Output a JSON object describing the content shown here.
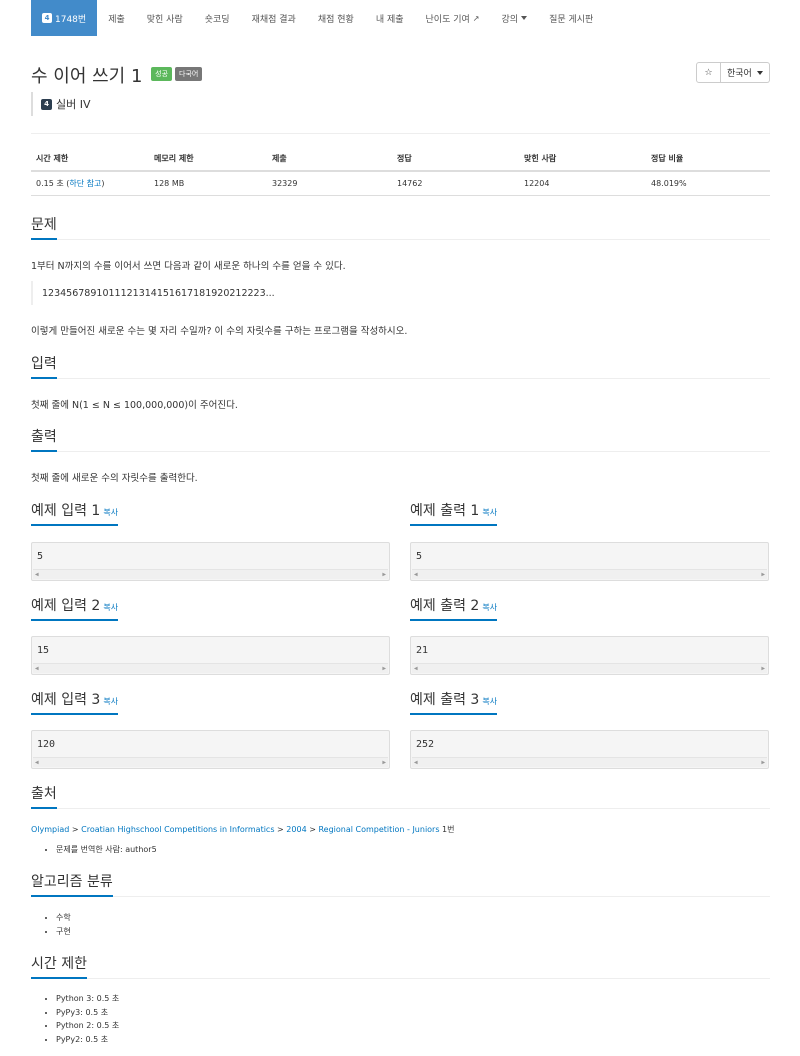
{
  "nav": {
    "problem_badge": "4",
    "problem_number": "1748번",
    "items": [
      "제출",
      "맞힌 사람",
      "숏코딩",
      "재채점 결과",
      "채점 현황",
      "내 제출",
      "난이도 기여",
      "강의",
      "질문 게시판"
    ]
  },
  "header": {
    "title": "수 이어 쓰기 1",
    "label_success": "성공",
    "label_multilang": "다국어",
    "star": "☆",
    "language": "한국어",
    "tier_badge": "4",
    "tier": "실버 IV"
  },
  "info": {
    "headers": [
      "시간 제한",
      "메모리 제한",
      "제출",
      "정답",
      "맞힌 사람",
      "정답 비율"
    ],
    "time_value": "0.15 초 (",
    "time_link": "하단 참고",
    "time_close": ")",
    "memory": "128 MB",
    "submissions": "32329",
    "accepted": "14762",
    "solvers": "12204",
    "ratio": "48.019%"
  },
  "problem": {
    "heading": "문제",
    "text1": "1부터 N까지의 수를 이어서 쓰면 다음과 같이 새로운 하나의 수를 얻을 수 있다.",
    "quote": "1234567891011121314151617181920212223...",
    "text2": "이렇게 만들어진 새로운 수는 몇 자리 수일까? 이 수의 자릿수를 구하는 프로그램을 작성하시오."
  },
  "input": {
    "heading": "입력",
    "text": "첫째 줄에 N(1 ≤ N ≤ 100,000,000)이 주어진다."
  },
  "output": {
    "heading": "출력",
    "text": "첫째 줄에 새로운 수의 자릿수를 출력한다."
  },
  "samples": {
    "copy": "복사",
    "items": [
      {
        "in_title": "예제 입력 1",
        "out_title": "예제 출력 1",
        "in": "5",
        "out": "5"
      },
      {
        "in_title": "예제 입력 2",
        "out_title": "예제 출력 2",
        "in": "15",
        "out": "21"
      },
      {
        "in_title": "예제 입력 3",
        "out_title": "예제 출력 3",
        "in": "120",
        "out": "252"
      }
    ]
  },
  "source": {
    "heading": "출처",
    "path": [
      "Olympiad",
      "Croatian Highschool Competitions in Informatics",
      "2004",
      "Regional Competition - Juniors"
    ],
    "separator": " > ",
    "suffix": " 1번",
    "translator": "문제를 번역한 사람: author5"
  },
  "algorithm": {
    "heading": "알고리즘 분류",
    "items": [
      "수학",
      "구현"
    ]
  },
  "time_limits": {
    "heading": "시간 제한",
    "items": [
      "Python 3: 0.5 초",
      "PyPy3: 0.5 초",
      "Python 2: 0.5 초",
      "PyPy2: 0.5 초"
    ]
  }
}
